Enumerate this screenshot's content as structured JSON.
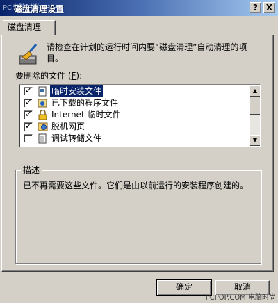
{
  "window": {
    "title": "磁盘清理设置",
    "title_watermark": "PC电脑时尚",
    "help_button": "?",
    "close_button": "X"
  },
  "tabs": [
    {
      "label": "磁盘清理",
      "active": true
    }
  ],
  "intro": {
    "text": "请检查在计划的运行时间内要“磁盘清理”自动清理的项目。",
    "icon": "broom-icon"
  },
  "files": {
    "label_prefix": "要删除的文件 (",
    "label_hotkey": "F",
    "label_suffix": "):",
    "items": [
      {
        "label": "临时安装文件",
        "checked": true,
        "selected": true,
        "icon": "setup-files-icon"
      },
      {
        "label": "已下载的程序文件",
        "checked": true,
        "selected": false,
        "icon": "downloaded-program-icon"
      },
      {
        "label": "Internet 临时文件",
        "checked": true,
        "selected": false,
        "icon": "lock-icon"
      },
      {
        "label": "脱机网页",
        "checked": true,
        "selected": false,
        "icon": "offline-page-icon"
      },
      {
        "label": "调试转储文件",
        "checked": false,
        "selected": false,
        "icon": "debug-dump-icon"
      }
    ]
  },
  "description": {
    "legend": "描述",
    "text": "已不再需要这些文件。它们是由以前运行的安装程序创建的。"
  },
  "buttons": {
    "ok": "确定",
    "cancel": "取消"
  },
  "watermark": "PCPOP.COM 电脑时尚",
  "colors": {
    "title_bar": "#0a246a",
    "selection": "#0a246a",
    "face": "#d4d0c8"
  }
}
